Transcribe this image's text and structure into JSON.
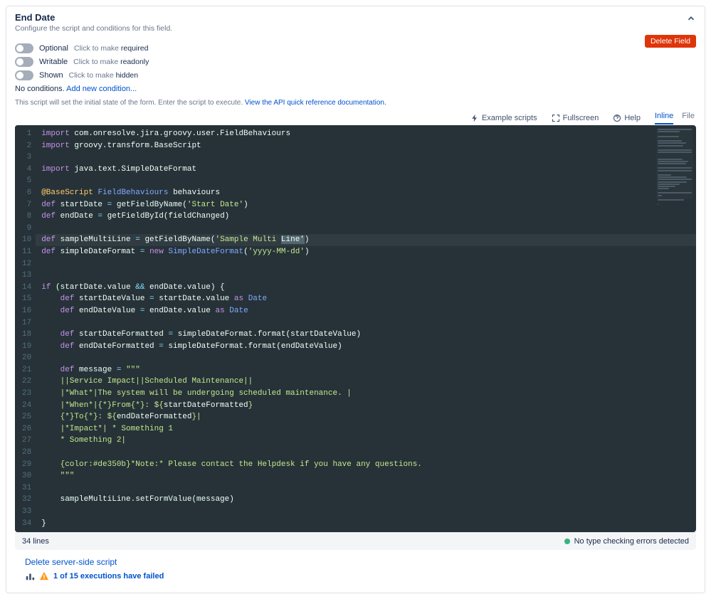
{
  "header": {
    "title": "End Date",
    "subtitle": "Configure the script and conditions for this field."
  },
  "deleteField": "Delete Field",
  "toggles": {
    "optional": {
      "label": "Optional",
      "hint_prefix": "Click to make ",
      "hint_emph": "required",
      "on": false
    },
    "writable": {
      "label": "Writable",
      "hint_prefix": "Click to make ",
      "hint_emph": "readonly",
      "on": false
    },
    "shown": {
      "label": "Shown",
      "hint_prefix": "Click to make ",
      "hint_emph": "hidden",
      "on": false
    }
  },
  "conditions": {
    "text": "No conditions. ",
    "link": "Add new condition..."
  },
  "scriptHint": {
    "text": "This script will set the initial state of the form. Enter the script to execute. ",
    "link": "View the API quick reference documentation."
  },
  "editorTools": {
    "example": "Example scripts",
    "fullscreen": "Fullscreen",
    "help": "Help"
  },
  "tabs": {
    "inline": "Inline",
    "file": "File",
    "active": "inline"
  },
  "footer": {
    "lines": "34 lines",
    "status": "No type checking errors detected"
  },
  "bottom": {
    "deleteScript": "Delete server-side script",
    "exec": "1 of 15 executions have failed"
  },
  "chart_data": null,
  "code": [
    {
      "n": 1,
      "t": [
        [
          "kw",
          "import"
        ],
        [
          "pl",
          " com.onresolve.jira.groovy.user.FieldBehaviours"
        ]
      ]
    },
    {
      "n": 2,
      "t": [
        [
          "kw",
          "import"
        ],
        [
          "pl",
          " groovy.transform.BaseScript"
        ]
      ]
    },
    {
      "n": 3,
      "t": []
    },
    {
      "n": 4,
      "t": [
        [
          "kw",
          "import"
        ],
        [
          "pl",
          " java.text.SimpleDateFormat"
        ]
      ]
    },
    {
      "n": 5,
      "t": []
    },
    {
      "n": 6,
      "t": [
        [
          "ann",
          "@BaseScript"
        ],
        [
          "pl",
          " "
        ],
        [
          "type",
          "FieldBehaviours"
        ],
        [
          "pl",
          " behaviours"
        ]
      ]
    },
    {
      "n": 7,
      "t": [
        [
          "kw",
          "def"
        ],
        [
          "pl",
          " startDate "
        ],
        [
          "op",
          "="
        ],
        [
          "pl",
          " getFieldByName("
        ],
        [
          "str",
          "'Start Date'"
        ],
        [
          "pl",
          ")"
        ]
      ]
    },
    {
      "n": 8,
      "t": [
        [
          "kw",
          "def"
        ],
        [
          "pl",
          " endDate "
        ],
        [
          "op",
          "="
        ],
        [
          "pl",
          " getFieldById(fieldChanged)"
        ]
      ]
    },
    {
      "n": 9,
      "t": []
    },
    {
      "n": 10,
      "t": [
        [
          "kw",
          "def"
        ],
        [
          "pl",
          " sampleMultiLine "
        ],
        [
          "op",
          "="
        ],
        [
          "pl",
          " getFieldByName("
        ],
        [
          "str",
          "'Sample Multi "
        ],
        [
          "sel",
          "Line'"
        ],
        [
          "pl",
          ")"
        ]
      ],
      "cursorAfter": true
    },
    {
      "n": 11,
      "t": [
        [
          "kw",
          "def"
        ],
        [
          "pl",
          " simpleDateFormat "
        ],
        [
          "op",
          "="
        ],
        [
          "pl",
          " "
        ],
        [
          "kw",
          "new"
        ],
        [
          "pl",
          " "
        ],
        [
          "type",
          "SimpleDateFormat"
        ],
        [
          "pl",
          "("
        ],
        [
          "str",
          "'yyyy-MM-dd'"
        ],
        [
          "pl",
          ")"
        ]
      ]
    },
    {
      "n": 12,
      "t": []
    },
    {
      "n": 13,
      "t": []
    },
    {
      "n": 14,
      "t": [
        [
          "kw",
          "if"
        ],
        [
          "pl",
          " (startDate.value "
        ],
        [
          "op",
          "&&"
        ],
        [
          "pl",
          " endDate.value) {"
        ]
      ]
    },
    {
      "n": 15,
      "t": [
        [
          "pl",
          "    "
        ],
        [
          "kw",
          "def"
        ],
        [
          "pl",
          " startDateValue "
        ],
        [
          "op",
          "="
        ],
        [
          "pl",
          " startDate.value "
        ],
        [
          "kw",
          "as"
        ],
        [
          "pl",
          " "
        ],
        [
          "type",
          "Date"
        ]
      ]
    },
    {
      "n": 16,
      "t": [
        [
          "pl",
          "    "
        ],
        [
          "kw",
          "def"
        ],
        [
          "pl",
          " endDateValue "
        ],
        [
          "op",
          "="
        ],
        [
          "pl",
          " endDate.value "
        ],
        [
          "kw",
          "as"
        ],
        [
          "pl",
          " "
        ],
        [
          "type",
          "Date"
        ]
      ]
    },
    {
      "n": 17,
      "t": []
    },
    {
      "n": 18,
      "t": [
        [
          "pl",
          "    "
        ],
        [
          "kw",
          "def"
        ],
        [
          "pl",
          " startDateFormatted "
        ],
        [
          "op",
          "="
        ],
        [
          "pl",
          " simpleDateFormat.format(startDateValue)"
        ]
      ]
    },
    {
      "n": 19,
      "t": [
        [
          "pl",
          "    "
        ],
        [
          "kw",
          "def"
        ],
        [
          "pl",
          " endDateFormatted "
        ],
        [
          "op",
          "="
        ],
        [
          "pl",
          " simpleDateFormat.format(endDateValue)"
        ]
      ]
    },
    {
      "n": 20,
      "t": []
    },
    {
      "n": 21,
      "t": [
        [
          "pl",
          "    "
        ],
        [
          "kw",
          "def"
        ],
        [
          "pl",
          " message "
        ],
        [
          "op",
          "="
        ],
        [
          "pl",
          " "
        ],
        [
          "str",
          "\"\"\""
        ]
      ]
    },
    {
      "n": 22,
      "t": [
        [
          "pl",
          "    "
        ],
        [
          "str",
          "||Service Impact||Scheduled Maintenance||"
        ]
      ]
    },
    {
      "n": 23,
      "t": [
        [
          "pl",
          "    "
        ],
        [
          "str",
          "|*What*|The system will be undergoing scheduled maintenance. |"
        ]
      ]
    },
    {
      "n": 24,
      "t": [
        [
          "pl",
          "    "
        ],
        [
          "str",
          "|*When*|{*}From{*}: ${"
        ],
        [
          "pl",
          "startDateFormatted"
        ],
        [
          "str",
          "}"
        ]
      ]
    },
    {
      "n": 25,
      "t": [
        [
          "pl",
          "    "
        ],
        [
          "str",
          "{*}To{*}: ${"
        ],
        [
          "pl",
          "endDateFormatted"
        ],
        [
          "str",
          "}|"
        ]
      ]
    },
    {
      "n": 26,
      "t": [
        [
          "pl",
          "    "
        ],
        [
          "str",
          "|*Impact*| * Something 1"
        ]
      ]
    },
    {
      "n": 27,
      "t": [
        [
          "pl",
          "    "
        ],
        [
          "str",
          "* Something 2|"
        ]
      ]
    },
    {
      "n": 28,
      "t": []
    },
    {
      "n": 29,
      "t": [
        [
          "pl",
          "    "
        ],
        [
          "str",
          "{color:#de350b}*Note:* Please contact the Helpdesk if you have any questions."
        ]
      ]
    },
    {
      "n": 30,
      "t": [
        [
          "pl",
          "    "
        ],
        [
          "str",
          "\"\"\""
        ]
      ]
    },
    {
      "n": 31,
      "t": []
    },
    {
      "n": 32,
      "t": [
        [
          "pl",
          "    sampleMultiLine.setFormValue(message)"
        ]
      ]
    },
    {
      "n": 33,
      "t": []
    },
    {
      "n": 34,
      "t": [
        [
          "pl",
          "}"
        ]
      ]
    }
  ]
}
